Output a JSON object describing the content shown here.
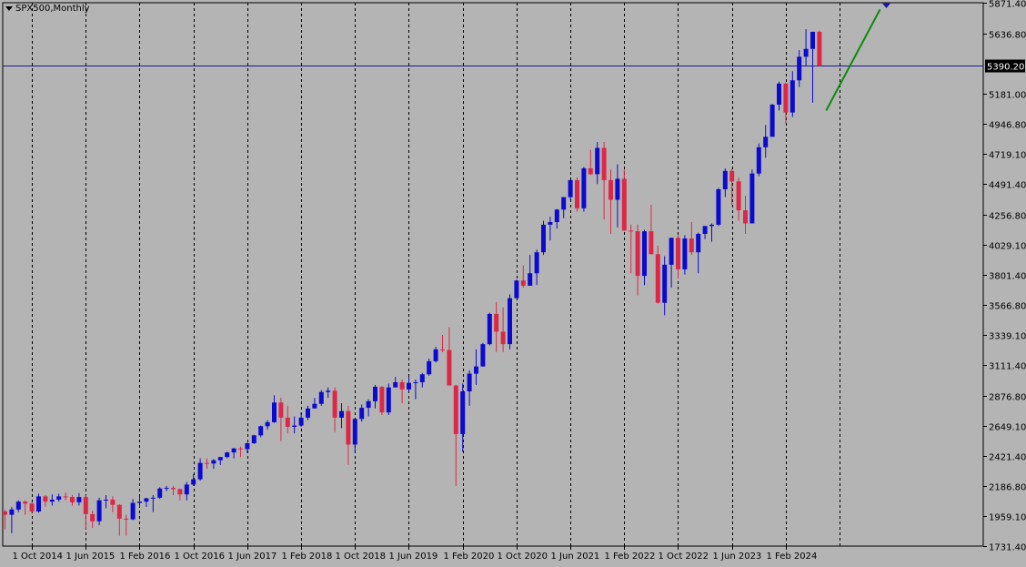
{
  "chart_title": "SPX500,Monthly",
  "colors": {
    "background": "#b4b4b4",
    "bull": "#0a0ad0",
    "bear": "#dc2846",
    "grid": "#000000",
    "price_line": "#1a1a9c",
    "trendline": "#0a8a0a",
    "axis_text": "#000000"
  },
  "chart_data": {
    "type": "candlestick",
    "timeframe": "Monthly",
    "symbol": "SPX500",
    "y_ticks": [
      "5871.40",
      "5636.80",
      "5181.00",
      "4946.80",
      "4719.10",
      "4491.40",
      "4256.80",
      "4029.10",
      "3801.40",
      "3566.80",
      "3339.10",
      "3111.40",
      "2876.80",
      "2649.10",
      "2421.40",
      "2186.80",
      "1959.10",
      "1731.40"
    ],
    "x_labels": [
      "1 Oct 2014",
      "1 Jun 2015",
      "1 Feb 2016",
      "1 Oct 2016",
      "1 Jun 2017",
      "1 Feb 2018",
      "1 Oct 2018",
      "1 Jun 2019",
      "1 Feb 2020",
      "1 Oct 2020",
      "1 Jun 2021",
      "1 Feb 2022",
      "1 Oct 2022",
      "1 Jun 2023",
      "1 Feb 2024"
    ],
    "ylim": [
      1731.4,
      5871.4
    ],
    "current_price": "5390.20",
    "grid": "vertical-dotted",
    "start": "Sep 2014",
    "ohlc": [
      [
        1995,
        2010,
        1860,
        1970
      ],
      [
        1970,
        2030,
        1830,
        2010
      ],
      [
        2010,
        2080,
        1990,
        2070
      ],
      [
        2070,
        2080,
        1970,
        2055
      ],
      [
        2055,
        2070,
        1980,
        1995
      ],
      [
        1995,
        2130,
        1985,
        2110
      ],
      [
        2110,
        2120,
        2030,
        2070
      ],
      [
        2070,
        2125,
        2040,
        2085
      ],
      [
        2085,
        2130,
        2070,
        2110
      ],
      [
        2110,
        2140,
        2080,
        2105
      ],
      [
        2105,
        2120,
        2040,
        2065
      ],
      [
        2065,
        2135,
        2040,
        2105
      ],
      [
        2105,
        2120,
        1860,
        1975
      ],
      [
        1975,
        2000,
        1870,
        1920
      ],
      [
        1920,
        2100,
        1890,
        2080
      ],
      [
        2080,
        2120,
        2020,
        2085
      ],
      [
        2085,
        2110,
        1990,
        2045
      ],
      [
        2045,
        2050,
        1810,
        1940
      ],
      [
        1940,
        1970,
        1810,
        1935
      ],
      [
        1935,
        2090,
        1930,
        2060
      ],
      [
        2060,
        2110,
        2030,
        2070
      ],
      [
        2070,
        2100,
        2030,
        2095
      ],
      [
        2095,
        2120,
        1990,
        2100
      ],
      [
        2100,
        2180,
        2090,
        2170
      ],
      [
        2170,
        2190,
        2150,
        2175
      ],
      [
        2175,
        2190,
        2120,
        2165
      ],
      [
        2165,
        2170,
        2080,
        2125
      ],
      [
        2125,
        2220,
        2080,
        2200
      ],
      [
        2200,
        2280,
        2190,
        2240
      ],
      [
        2240,
        2400,
        2230,
        2365
      ],
      [
        2365,
        2400,
        2320,
        2360
      ],
      [
        2360,
        2395,
        2320,
        2385
      ],
      [
        2385,
        2410,
        2350,
        2410
      ],
      [
        2410,
        2450,
        2400,
        2445
      ],
      [
        2445,
        2480,
        2400,
        2475
      ],
      [
        2475,
        2490,
        2410,
        2470
      ],
      [
        2470,
        2520,
        2440,
        2515
      ],
      [
        2515,
        2580,
        2510,
        2575
      ],
      [
        2575,
        2650,
        2560,
        2645
      ],
      [
        2645,
        2690,
        2620,
        2675
      ],
      [
        2675,
        2880,
        2670,
        2825
      ],
      [
        2825,
        2860,
        2530,
        2710
      ],
      [
        2710,
        2800,
        2590,
        2640
      ],
      [
        2640,
        2720,
        2590,
        2650
      ],
      [
        2650,
        2750,
        2640,
        2710
      ],
      [
        2710,
        2800,
        2690,
        2780
      ],
      [
        2780,
        2860,
        2790,
        2815
      ],
      [
        2815,
        2920,
        2800,
        2905
      ],
      [
        2905,
        2940,
        2860,
        2915
      ],
      [
        2915,
        2940,
        2600,
        2710
      ],
      [
        2710,
        2820,
        2630,
        2760
      ],
      [
        2760,
        2800,
        2350,
        2505
      ],
      [
        2505,
        2710,
        2440,
        2700
      ],
      [
        2700,
        2810,
        2680,
        2785
      ],
      [
        2785,
        2850,
        2720,
        2835
      ],
      [
        2835,
        2960,
        2780,
        2945
      ],
      [
        2945,
        2950,
        2730,
        2750
      ],
      [
        2750,
        2970,
        2730,
        2940
      ],
      [
        2940,
        3020,
        2950,
        2980
      ],
      [
        2980,
        3000,
        2820,
        2925
      ],
      [
        2925,
        3020,
        2910,
        2975
      ],
      [
        2975,
        3000,
        2850,
        2980
      ],
      [
        2980,
        3050,
        2940,
        3040
      ],
      [
        3040,
        3160,
        3030,
        3140
      ],
      [
        3140,
        3250,
        3130,
        3230
      ],
      [
        3230,
        3340,
        3210,
        3225
      ],
      [
        3225,
        3400,
        3180,
        2955
      ],
      [
        2955,
        2960,
        2190,
        2585
      ],
      [
        2585,
        2970,
        2450,
        2910
      ],
      [
        2910,
        3070,
        2800,
        3045
      ],
      [
        3045,
        3230,
        2960,
        3100
      ],
      [
        3100,
        3280,
        3100,
        3270
      ],
      [
        3270,
        3510,
        3260,
        3500
      ],
      [
        3500,
        3590,
        3210,
        3365
      ],
      [
        3365,
        3550,
        3210,
        3270
      ],
      [
        3270,
        3650,
        3230,
        3620
      ],
      [
        3620,
        3760,
        3620,
        3755
      ],
      [
        3755,
        3870,
        3700,
        3715
      ],
      [
        3715,
        3950,
        3720,
        3810
      ],
      [
        3810,
        3990,
        3720,
        3970
      ],
      [
        3970,
        4210,
        3950,
        4180
      ],
      [
        4180,
        4240,
        4060,
        4200
      ],
      [
        4200,
        4300,
        4150,
        4295
      ],
      [
        4295,
        4390,
        4230,
        4390
      ],
      [
        4390,
        4520,
        4370,
        4520
      ],
      [
        4520,
        4540,
        4280,
        4305
      ],
      [
        4305,
        4620,
        4280,
        4610
      ],
      [
        4610,
        4750,
        4560,
        4565
      ],
      [
        4565,
        4810,
        4490,
        4765
      ],
      [
        4765,
        4810,
        4220,
        4520
      ],
      [
        4520,
        4600,
        4110,
        4370
      ],
      [
        4370,
        4640,
        4160,
        4530
      ],
      [
        4530,
        4600,
        4140,
        4135
      ],
      [
        4135,
        4180,
        3810,
        4130
      ],
      [
        4130,
        4180,
        3640,
        3790
      ],
      [
        3790,
        4140,
        3720,
        4130
      ],
      [
        4130,
        4330,
        3960,
        3955
      ],
      [
        3955,
        4020,
        3580,
        3585
      ],
      [
        3585,
        3940,
        3490,
        3875
      ],
      [
        3875,
        4080,
        3700,
        4080
      ],
      [
        4080,
        4100,
        3770,
        3840
      ],
      [
        3840,
        4100,
        3800,
        4075
      ],
      [
        4075,
        4200,
        3950,
        3970
      ],
      [
        3970,
        4120,
        3810,
        4110
      ],
      [
        4110,
        4170,
        4070,
        4170
      ],
      [
        4170,
        4190,
        4050,
        4180
      ],
      [
        4180,
        4460,
        4170,
        4450
      ],
      [
        4450,
        4610,
        4390,
        4590
      ],
      [
        4590,
        4610,
        4330,
        4510
      ],
      [
        4510,
        4540,
        4210,
        4290
      ],
      [
        4290,
        4400,
        4110,
        4190
      ],
      [
        4190,
        4600,
        4190,
        4570
      ],
      [
        4570,
        4800,
        4550,
        4770
      ],
      [
        4770,
        4940,
        4690,
        4850
      ],
      [
        4850,
        5100,
        4850,
        5095
      ],
      [
        5095,
        5270,
        5050,
        5255
      ],
      [
        5255,
        5265,
        4950,
        5035
      ],
      [
        5035,
        5350,
        5000,
        5280
      ],
      [
        5280,
        5510,
        5230,
        5460
      ],
      [
        5460,
        5670,
        5390,
        5520
      ],
      [
        5520,
        5650,
        5110,
        5650
      ],
      [
        5650,
        5660,
        5390,
        5390
      ]
    ],
    "trendline_points": [
      [
        122,
        5050
      ],
      [
        130,
        5820
      ]
    ],
    "note_marker_index": 130
  }
}
